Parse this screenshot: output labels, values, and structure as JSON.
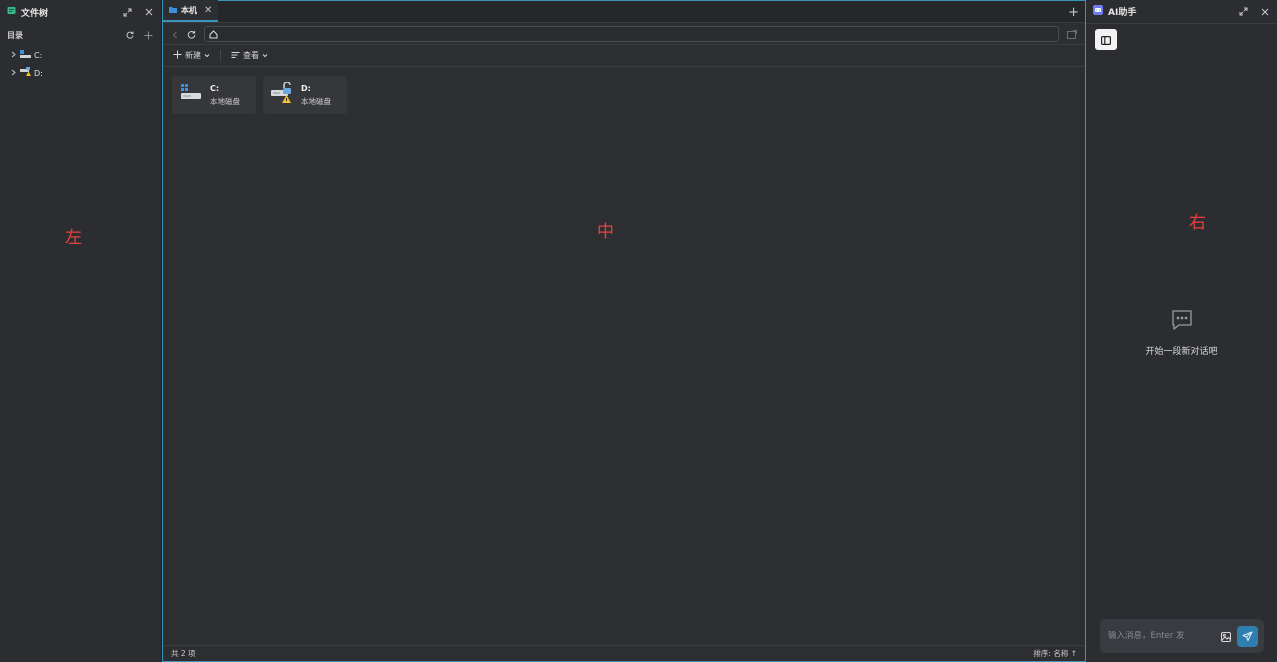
{
  "left": {
    "title": "文件树",
    "section_label": "目录",
    "items": [
      {
        "label": "C:"
      },
      {
        "label": "D:"
      }
    ],
    "zone_label": "左"
  },
  "center": {
    "tab": {
      "label": "本机"
    },
    "toolbar": {
      "new_label": "新建",
      "view_label": "查看"
    },
    "drives": [
      {
        "name": "C:",
        "desc": "本地磁盘"
      },
      {
        "name": "D:",
        "desc": "本地磁盘"
      }
    ],
    "status": {
      "count": "共 2 项",
      "sort": "排序: 名称 ↑"
    },
    "zone_label": "中"
  },
  "right": {
    "title": "AI助手",
    "empty_text": "开始一段新对话吧",
    "input_placeholder": "输入消息，Enter 发",
    "zone_label": "右"
  },
  "colors": {
    "accent": "#3a93b8",
    "zone_label": "#e8413e",
    "send": "#2f7fae",
    "background": "#2c2d30"
  }
}
